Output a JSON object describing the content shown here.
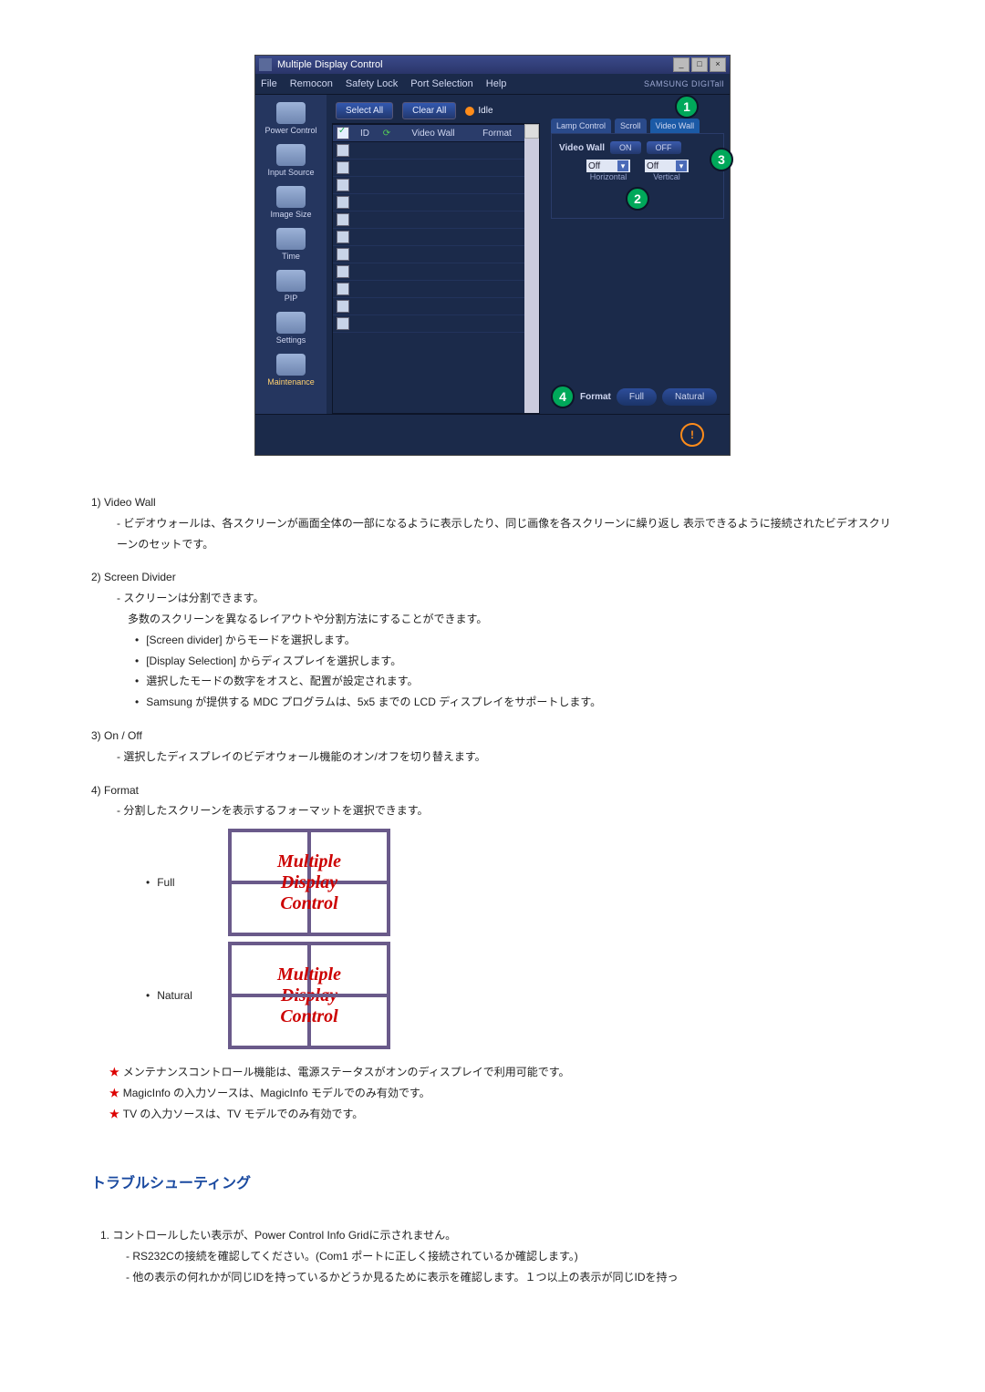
{
  "app": {
    "title": "Multiple Display Control",
    "menu": [
      "File",
      "Remocon",
      "Safety Lock",
      "Port Selection",
      "Help"
    ],
    "brand": "SAMSUNG DIGITall"
  },
  "sidebar": {
    "items": [
      {
        "label": "Power Control"
      },
      {
        "label": "Input Source"
      },
      {
        "label": "Image Size"
      },
      {
        "label": "Time"
      },
      {
        "label": "PIP"
      },
      {
        "label": "Settings"
      },
      {
        "label": "Maintenance"
      }
    ]
  },
  "toolbar": {
    "select_all": "Select All",
    "clear_all": "Clear All",
    "idle": "Idle"
  },
  "grid": {
    "headers": {
      "id": "ID",
      "video_wall": "Video Wall",
      "format": "Format"
    }
  },
  "right": {
    "tabs": {
      "lamp": "Lamp Control",
      "scroll": "Scroll",
      "video_wall": "Video Wall"
    },
    "label_video_wall": "Video Wall",
    "on": "ON",
    "off": "OFF",
    "hdd": {
      "value": "Off",
      "label": "Horizontal"
    },
    "vdd": {
      "value": "Off",
      "label": "Vertical"
    },
    "format_label": "Format",
    "full": "Full",
    "natural": "Natural"
  },
  "annot": {
    "n1": "1",
    "n2": "2",
    "n3": "3",
    "n4": "4"
  },
  "doc": {
    "s1": {
      "h": "1)  Video Wall",
      "d": "- ビデオウォールは、各スクリーンが画面全体の一部になるように表示したり、同じ画像を各スクリーンに繰り返し 表示できるように接続されたビデオスクリーンのセットです。"
    },
    "s2": {
      "h": "2)  Screen Divider",
      "d": "- スクリーンは分割できます。",
      "d2": "多数のスクリーンを異なるレイアウトや分割方法にすることができます。",
      "b1": "[Screen divider] からモードを選択します。",
      "b2": "[Display Selection] からディスプレイを選択します。",
      "b3": "選択したモードの数字をオスと、配置が設定されます。",
      "b4": "Samsung が提供する MDC プログラムは、5x5 までの LCD ディスプレイをサポートします。"
    },
    "s3": {
      "h": "3)  On / Off",
      "d": "- 選択したディスプレイのビデオウォール機能のオン/オフを切り替えます。"
    },
    "s4": {
      "h": "4)  Format",
      "d": "- 分割したスクリーンを表示するフォーマットを選択できます。",
      "full": "Full",
      "natural": "Natural"
    },
    "notes": {
      "n1": "メンテナンスコントロール機能は、電源ステータスがオンのディスプレイで利用可能です。",
      "n2": "MagicInfo の入力ソースは、MagicInfo モデルでのみ有効です。",
      "n3": "TV の入力ソースは、TV モデルでのみ有効です。"
    },
    "mdc": {
      "l1": "Multiple",
      "l2": "Display",
      "l3": "Control"
    }
  },
  "troubleshoot": {
    "title": "トラブルシューティング",
    "t1": "1. コントロールしたい表示が、Power Control Info Gridに示されません。",
    "t1a": "- RS232Cの接続を確認してください。(Com1 ポートに正しく接続されているか確認します。)",
    "t1b": "- 他の表示の何れかが同じIDを持っているかどうか見るために表示を確認します。１つ以上の表示が同じIDを持っ"
  }
}
